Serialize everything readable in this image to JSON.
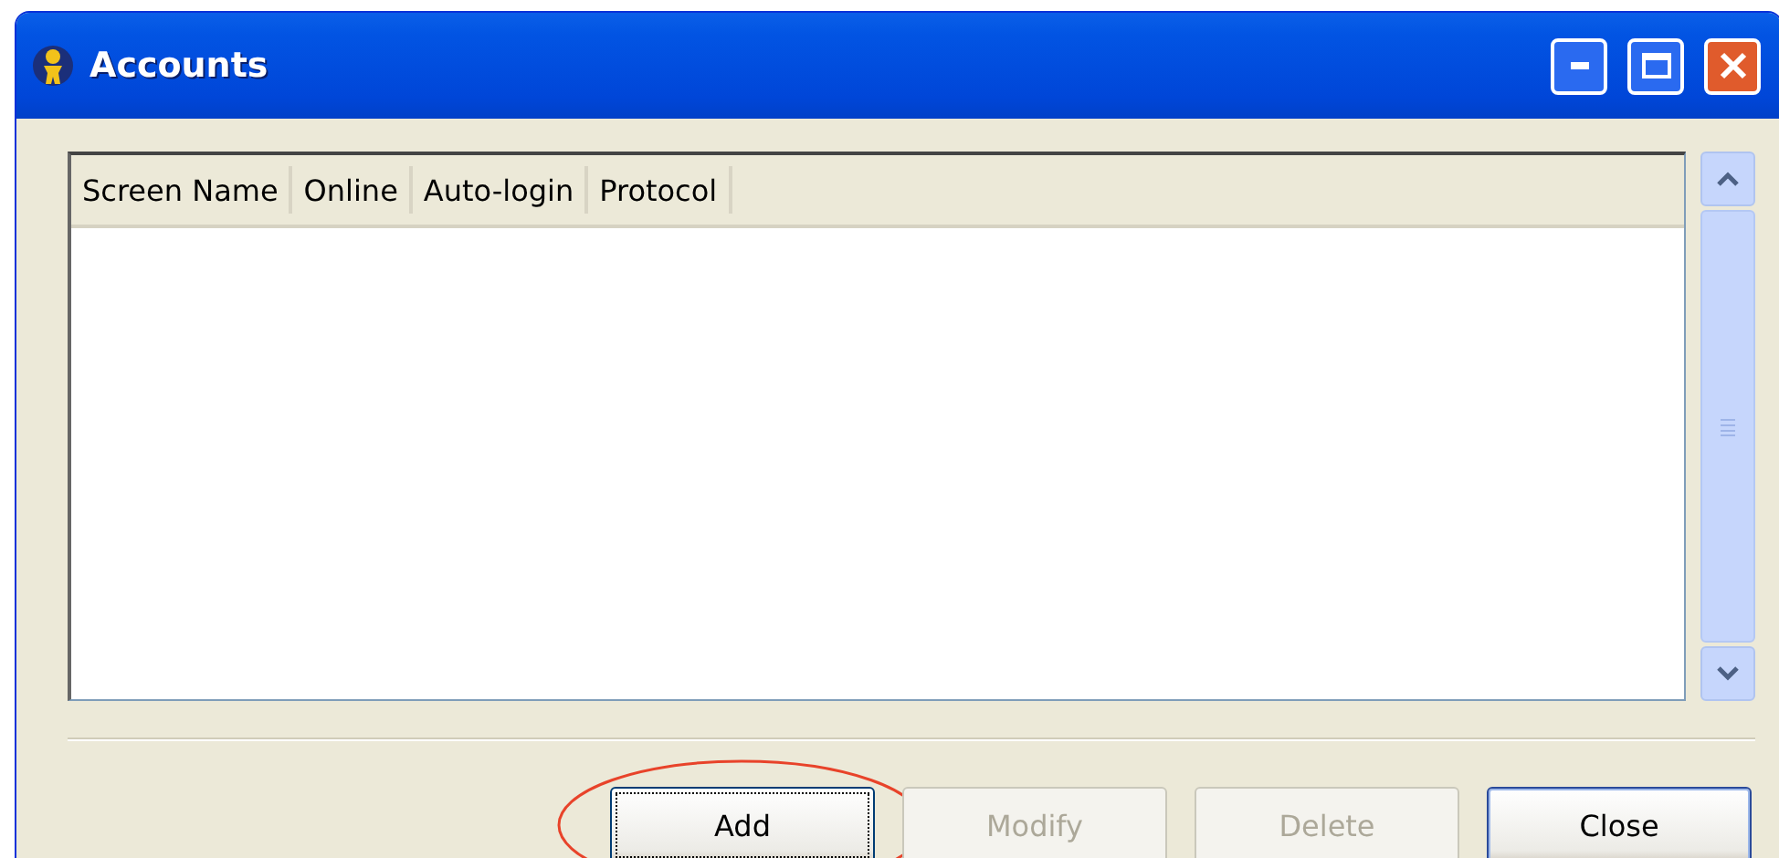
{
  "window": {
    "title": "Accounts"
  },
  "table": {
    "columns": [
      "Screen Name",
      "Online",
      "Auto-login",
      "Protocol"
    ]
  },
  "buttons": [
    {
      "label": "Add",
      "disabled": false,
      "focused": true,
      "default": false,
      "highlighted": true
    },
    {
      "label": "Modify",
      "disabled": true,
      "focused": false,
      "default": false,
      "highlighted": false
    },
    {
      "label": "Delete",
      "disabled": true,
      "focused": false,
      "default": false,
      "highlighted": false
    },
    {
      "label": "Close",
      "disabled": false,
      "focused": false,
      "default": true,
      "highlighted": false
    }
  ]
}
